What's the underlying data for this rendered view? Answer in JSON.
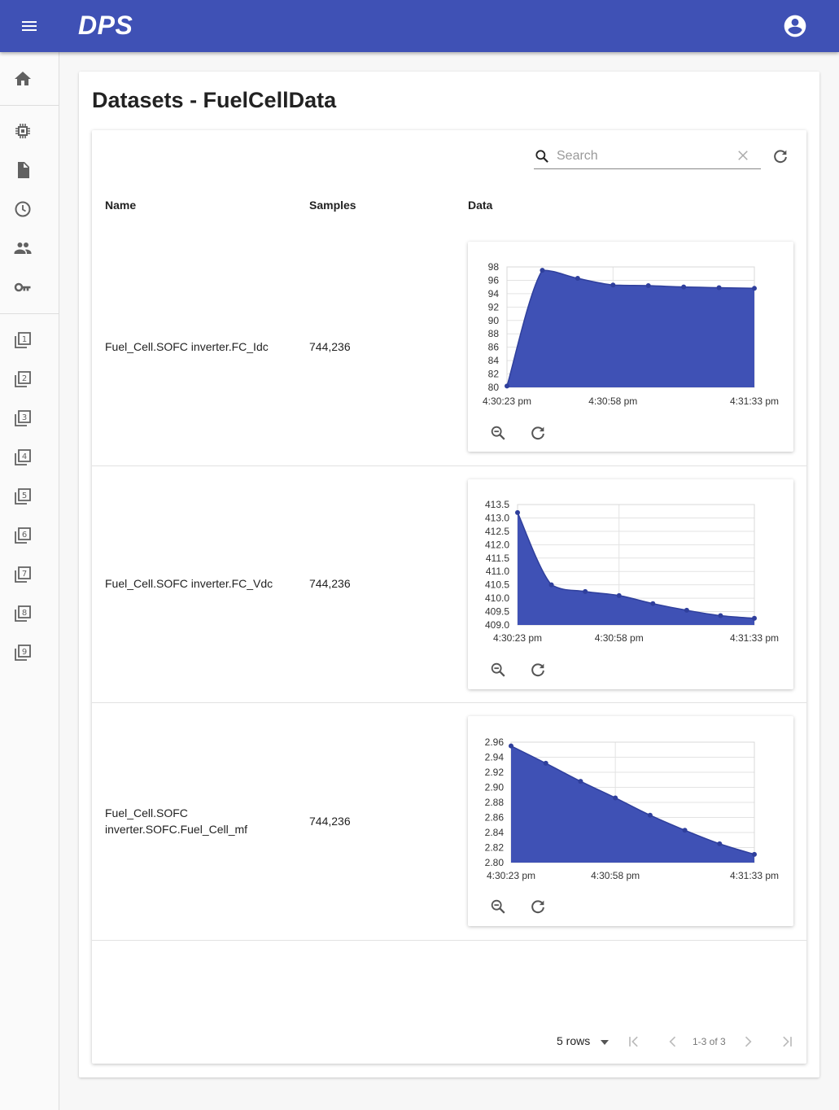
{
  "app": {
    "logo": "DPS"
  },
  "page": {
    "title": "Datasets - FuelCellData"
  },
  "search": {
    "placeholder": "Search",
    "value": ""
  },
  "table": {
    "headers": {
      "name": "Name",
      "samples": "Samples",
      "data": "Data"
    },
    "rows": [
      {
        "name": "Fuel_Cell.SOFC inverter.FC_Idc",
        "samples": "744,236",
        "chart": {
          "type": "area",
          "x": [
            "4:30:23 pm",
            "4:30:58 pm",
            "4:31:33 pm"
          ],
          "yticks": [
            "98",
            "96",
            "94",
            "92",
            "90",
            "88",
            "86",
            "84",
            "82",
            "80"
          ]
        }
      },
      {
        "name": "Fuel_Cell.SOFC inverter.FC_Vdc",
        "samples": "744,236",
        "chart": {
          "type": "area",
          "x": [
            "4:30:23 pm",
            "4:30:58 pm",
            "4:31:33 pm"
          ],
          "yticks": [
            "413.5",
            "413.0",
            "412.5",
            "412.0",
            "411.5",
            "411.0",
            "410.5",
            "410.0",
            "409.5",
            "409.0"
          ]
        }
      },
      {
        "name_line1": "Fuel_Cell.SOFC",
        "name_line2": "inverter.SOFC.Fuel_Cell_mf",
        "samples": "744,236",
        "chart": {
          "type": "area",
          "x": [
            "4:30:23 pm",
            "4:30:58 pm",
            "4:31:33 pm"
          ],
          "yticks": [
            "2.96",
            "2.94",
            "2.92",
            "2.90",
            "2.88",
            "2.86",
            "2.84",
            "2.82",
            "2.80"
          ]
        }
      }
    ]
  },
  "chart_data": [
    {
      "type": "area",
      "title": "",
      "xlabel": "",
      "ylabel": "",
      "x": [
        "4:30:23 pm",
        "",
        "",
        "4:30:58 pm",
        "",
        "",
        "",
        "4:31:33 pm"
      ],
      "series": [
        {
          "values": [
            80.2,
            97.5,
            96.3,
            95.3,
            95.2,
            95.0,
            94.9,
            94.8
          ]
        }
      ],
      "ylim": [
        80,
        98
      ],
      "grid": true,
      "color": "#3f51b5"
    },
    {
      "type": "area",
      "title": "",
      "xlabel": "",
      "ylabel": "",
      "x": [
        "4:30:23 pm",
        "",
        "",
        "4:30:58 pm",
        "",
        "",
        "",
        "4:31:33 pm"
      ],
      "series": [
        {
          "values": [
            413.2,
            410.5,
            410.25,
            410.1,
            409.8,
            409.55,
            409.35,
            409.25
          ]
        }
      ],
      "ylim": [
        409.0,
        413.5
      ],
      "grid": true,
      "color": "#3f51b5"
    },
    {
      "type": "area",
      "title": "",
      "xlabel": "",
      "ylabel": "",
      "x": [
        "4:30:23 pm",
        "",
        "",
        "4:30:58 pm",
        "",
        "",
        "",
        "4:31:33 pm"
      ],
      "series": [
        {
          "values": [
            2.955,
            2.932,
            2.908,
            2.886,
            2.863,
            2.843,
            2.825,
            2.811
          ]
        }
      ],
      "ylim": [
        2.8,
        2.96
      ],
      "grid": true,
      "color": "#3f51b5"
    }
  ],
  "pagination": {
    "rows_label": "5 rows",
    "range": "1-3 of 3"
  },
  "icons": {
    "menu": "menu-icon",
    "account": "account-circle-icon",
    "sidebar": [
      "home-icon",
      "chip-icon",
      "file-icon",
      "clock-icon",
      "people-icon",
      "key-icon",
      "filter-1-icon",
      "filter-2-icon",
      "filter-3-icon",
      "filter-4-icon",
      "filter-5-icon",
      "filter-6-icon",
      "filter-7-icon",
      "filter-8-icon",
      "filter-9-icon"
    ]
  },
  "colors": {
    "primary": "#3f51b5",
    "area": "#3f51b5"
  }
}
